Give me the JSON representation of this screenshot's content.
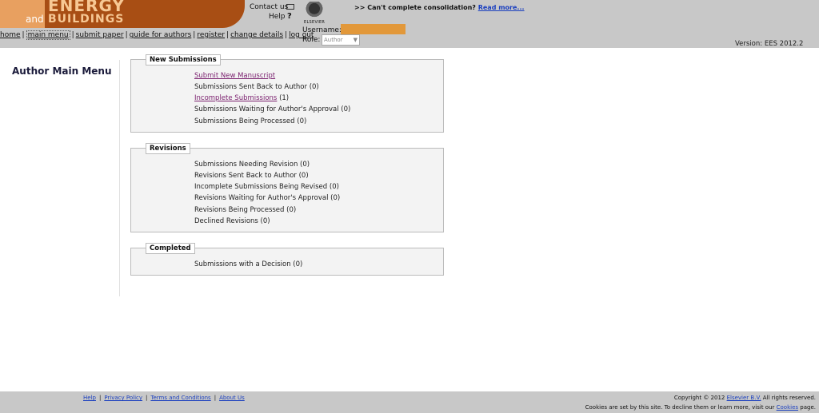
{
  "header": {
    "logo": {
      "line1": "ENERGY",
      "and": "and",
      "line2": "BUILDINGS"
    },
    "contact_label": "Contact us",
    "help_label": "Help",
    "help_icon": "?",
    "elsevier_word": "ELSEVIER",
    "notice_text": ">> Can't complete consolidation?",
    "notice_link": "Read more...",
    "username_label": "Username:",
    "role_label": "Role:",
    "role_value": "Author",
    "version": "Version: EES 2012.2",
    "accent_color": "#a84e14"
  },
  "nav": {
    "items": [
      "home",
      "main menu",
      "submit paper",
      "guide for authors",
      "register",
      "change details",
      "log out"
    ],
    "separator": "|"
  },
  "page_title": "Author Main Menu",
  "sections": {
    "new": {
      "title": "New Submissions",
      "items": [
        {
          "label": "Submit New Manuscript",
          "count": ""
        },
        {
          "label": "Submissions Sent Back to Author",
          "count": "(0)"
        },
        {
          "label": "Incomplete Submissions",
          "count": "(1)"
        },
        {
          "label": "Submissions Waiting for Author's Approval",
          "count": "(0)"
        },
        {
          "label": "Submissions Being Processed",
          "count": "(0)"
        }
      ]
    },
    "revisions": {
      "title": "Revisions",
      "items": [
        {
          "label": "Submissions Needing Revision",
          "count": "(0)"
        },
        {
          "label": "Revisions Sent Back to Author",
          "count": "(0)"
        },
        {
          "label": "Incomplete Submissions Being Revised",
          "count": "(0)"
        },
        {
          "label": "Revisions Waiting for Author's Approval",
          "count": "(0)"
        },
        {
          "label": "Revisions Being Processed",
          "count": "(0)"
        },
        {
          "label": "Declined Revisions",
          "count": "(0)"
        }
      ]
    },
    "completed": {
      "title": "Completed",
      "items": [
        {
          "label": "Submissions with a Decision",
          "count": "(0)"
        }
      ]
    }
  },
  "footer": {
    "links": [
      "Help",
      "Privacy Policy",
      "Terms and Conditions",
      "About Us"
    ],
    "separator": "|",
    "copyright_prefix": "Copyright © 2012",
    "copyright_link": "Elsevier B.V.",
    "copyright_suffix": "All rights reserved.",
    "cookies_prefix": "Cookies are set by this site. To decline them or learn more, visit our",
    "cookies_link": "Cookies",
    "cookies_suffix": "page."
  }
}
